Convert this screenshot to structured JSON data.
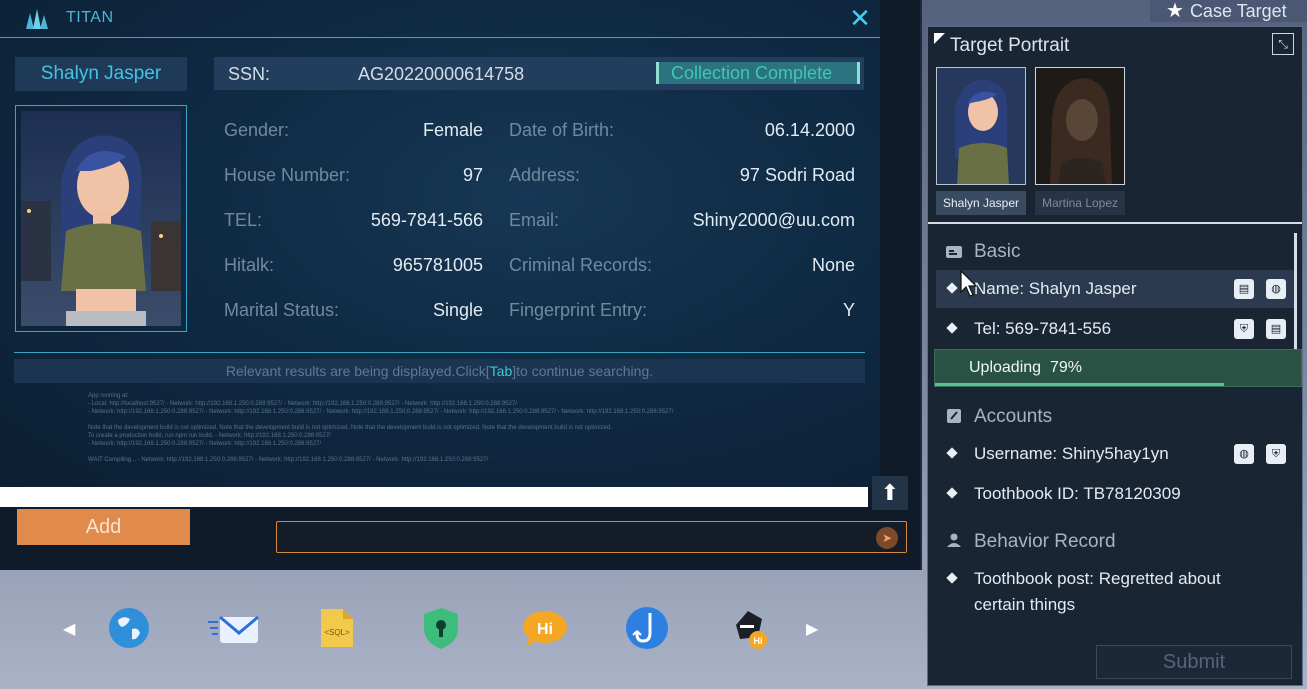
{
  "titan": {
    "title": "TITAN",
    "close": "✕",
    "person_name": "Shalyn Jasper",
    "ssn_label": "SSN:",
    "ssn_value": "AG20220000614758",
    "collection_status": "Collection Complete",
    "fields": {
      "gender_label": "Gender:",
      "gender_value": "Female",
      "dob_label": "Date of Birth:",
      "dob_value": "06.14.2000",
      "house_label": "House Number:",
      "house_value": "97",
      "address_label": "Address:",
      "address_value": "97 Sodri Road",
      "tel_label": "TEL:",
      "tel_value": "569-7841-566",
      "email_label": "Email:",
      "email_value": "Shiny2000@uu.com",
      "hitalk_label": "Hitalk:",
      "hitalk_value": "965781005",
      "criminal_label": "Criminal Records:",
      "criminal_value": "None",
      "marital_label": "Marital Status:",
      "marital_value": "Single",
      "fingerprint_label": "Fingerprint Entry:",
      "fingerprint_value": "Y"
    },
    "result_text_pre": "Relevant results are being displayed.Click[",
    "result_tab": "Tab",
    "result_text_post": "]to continue searching.",
    "console_lines": [
      "App running at:",
      "- Local:   http://localhost:9527/   - Network: http://192.168.1.250:0.288:9527/   - Network: http://192.168.1.250:0.288:9527/   - Network: http://192.168.1.250:0.288:9527/",
      "- Network: http://192.168.1.250:0.288:9527/   - Network: http://192.168.1.250:0.288:9527/   - Network: http://192.168.1.250:0.288:9527/   - Network: http://192.168.1.250:0.288:9527/   - Network: http://192.168.1.250:0.288:9527/",
      "",
      "Note that the development build is not optimized.   Note that the development build is not optimized.   Note that the development build is not optimized.   Note that the development build is not optimized.",
      "To create a production build, run npm run build.  - Network: http://192.168.1.250:0.288:9527/",
      "- Network: http://192.168.1.250:0.288:9527/   - Network: http://192.168.1.250:0.288:9527/",
      "",
      "WAIT  Compiling...   - Network: http://192.168.1.250:0.288:9527/   - Network: http://192.168.1.250:0.288:9527/   - Network: http://192.168.1.250:0.288:9527/"
    ],
    "scroll_up": "⬆",
    "add_label": "Add",
    "chat_placeholder": ""
  },
  "taskbar": {
    "left_arrow": "◀",
    "right_arrow": "▶",
    "icons": [
      "browser-globe-icon",
      "mail-icon",
      "sql-file-icon",
      "shield-lock-icon",
      "hi-chat-icon",
      "fishhook-icon",
      "hacker-hi-icon"
    ],
    "sql_text": "<SQL>",
    "hi_text": "Hi"
  },
  "right_panel": {
    "case_target_label": "Case Target",
    "portrait_title": "Target Portrait",
    "targets": [
      "Shalyn Jasper",
      "Martina Lopez"
    ],
    "basic_title": "Basic",
    "basic_items": [
      "Name: Shalyn Jasper",
      "Tel: 569-7841-556"
    ],
    "uploading_label": "Uploading",
    "uploading_percent": "79%",
    "upload_progress": 0.79,
    "accounts_title": "Accounts",
    "accounts_items": [
      "Username: Shiny5hay1yn",
      "Toothbook ID: TB78120309"
    ],
    "behavior_title": "Behavior Record",
    "behavior_items": [
      "Toothbook post: Regretted about certain things"
    ],
    "submit_label": "Submit"
  },
  "colors": {
    "accent_cyan": "#3aa6c4",
    "upload_green": "#2a5244",
    "add_orange": "#e08a4b"
  }
}
